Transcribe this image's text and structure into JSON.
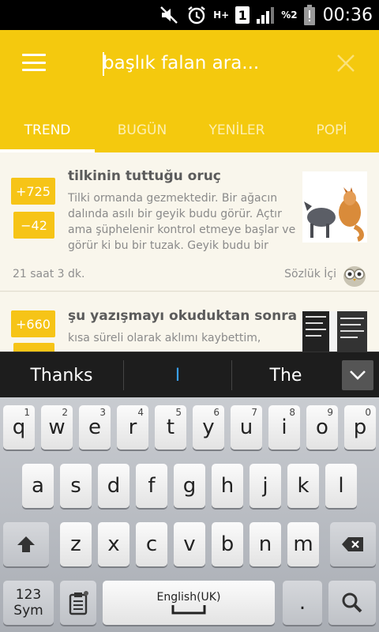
{
  "status_bar": {
    "network": "H+",
    "sim_slot": "1",
    "battery": "%2",
    "time": "00:36"
  },
  "header": {
    "search_placeholder": "başlık falan ara..."
  },
  "tabs": [
    {
      "label": "TREND"
    },
    {
      "label": "BUGÜN"
    },
    {
      "label": "YENİLER"
    },
    {
      "label": "POPİ"
    }
  ],
  "entries": [
    {
      "upvotes": "+725",
      "downvotes": "−42",
      "title": "tilkinin tuttuğu oruç",
      "excerpt": "Tilki ormanda gezmektedir. Bir ağacın dalında asılı bir geyik budu görür. Açtır ama şüphelenir kontrol etmeye başlar ve görür ki bu bir tuzak. Geyik budu bir",
      "time": "21 saat 3 dk.",
      "source": "Sözlük İçi"
    },
    {
      "upvotes": "+660",
      "title": "şu yazışmayı okuduktan sonra",
      "excerpt": "kısa süreli olarak aklımı kaybettim,"
    }
  ],
  "suggestions": {
    "left": "Thanks",
    "center": "I",
    "right": "The"
  },
  "keyboard": {
    "row1": [
      {
        "char": "q",
        "num": "1"
      },
      {
        "char": "w",
        "num": "2"
      },
      {
        "char": "e",
        "num": "3"
      },
      {
        "char": "r",
        "num": "4"
      },
      {
        "char": "t",
        "num": "5"
      },
      {
        "char": "y",
        "num": "6"
      },
      {
        "char": "u",
        "num": "7"
      },
      {
        "char": "i",
        "num": "8"
      },
      {
        "char": "o",
        "num": "9"
      },
      {
        "char": "p",
        "num": "0"
      }
    ],
    "row2": [
      "a",
      "s",
      "d",
      "f",
      "g",
      "h",
      "j",
      "k",
      "l"
    ],
    "row3": [
      "z",
      "x",
      "c",
      "v",
      "b",
      "n",
      "m"
    ],
    "sym_label": "123\nSym",
    "space_label": "English(UK)",
    "period": "."
  }
}
